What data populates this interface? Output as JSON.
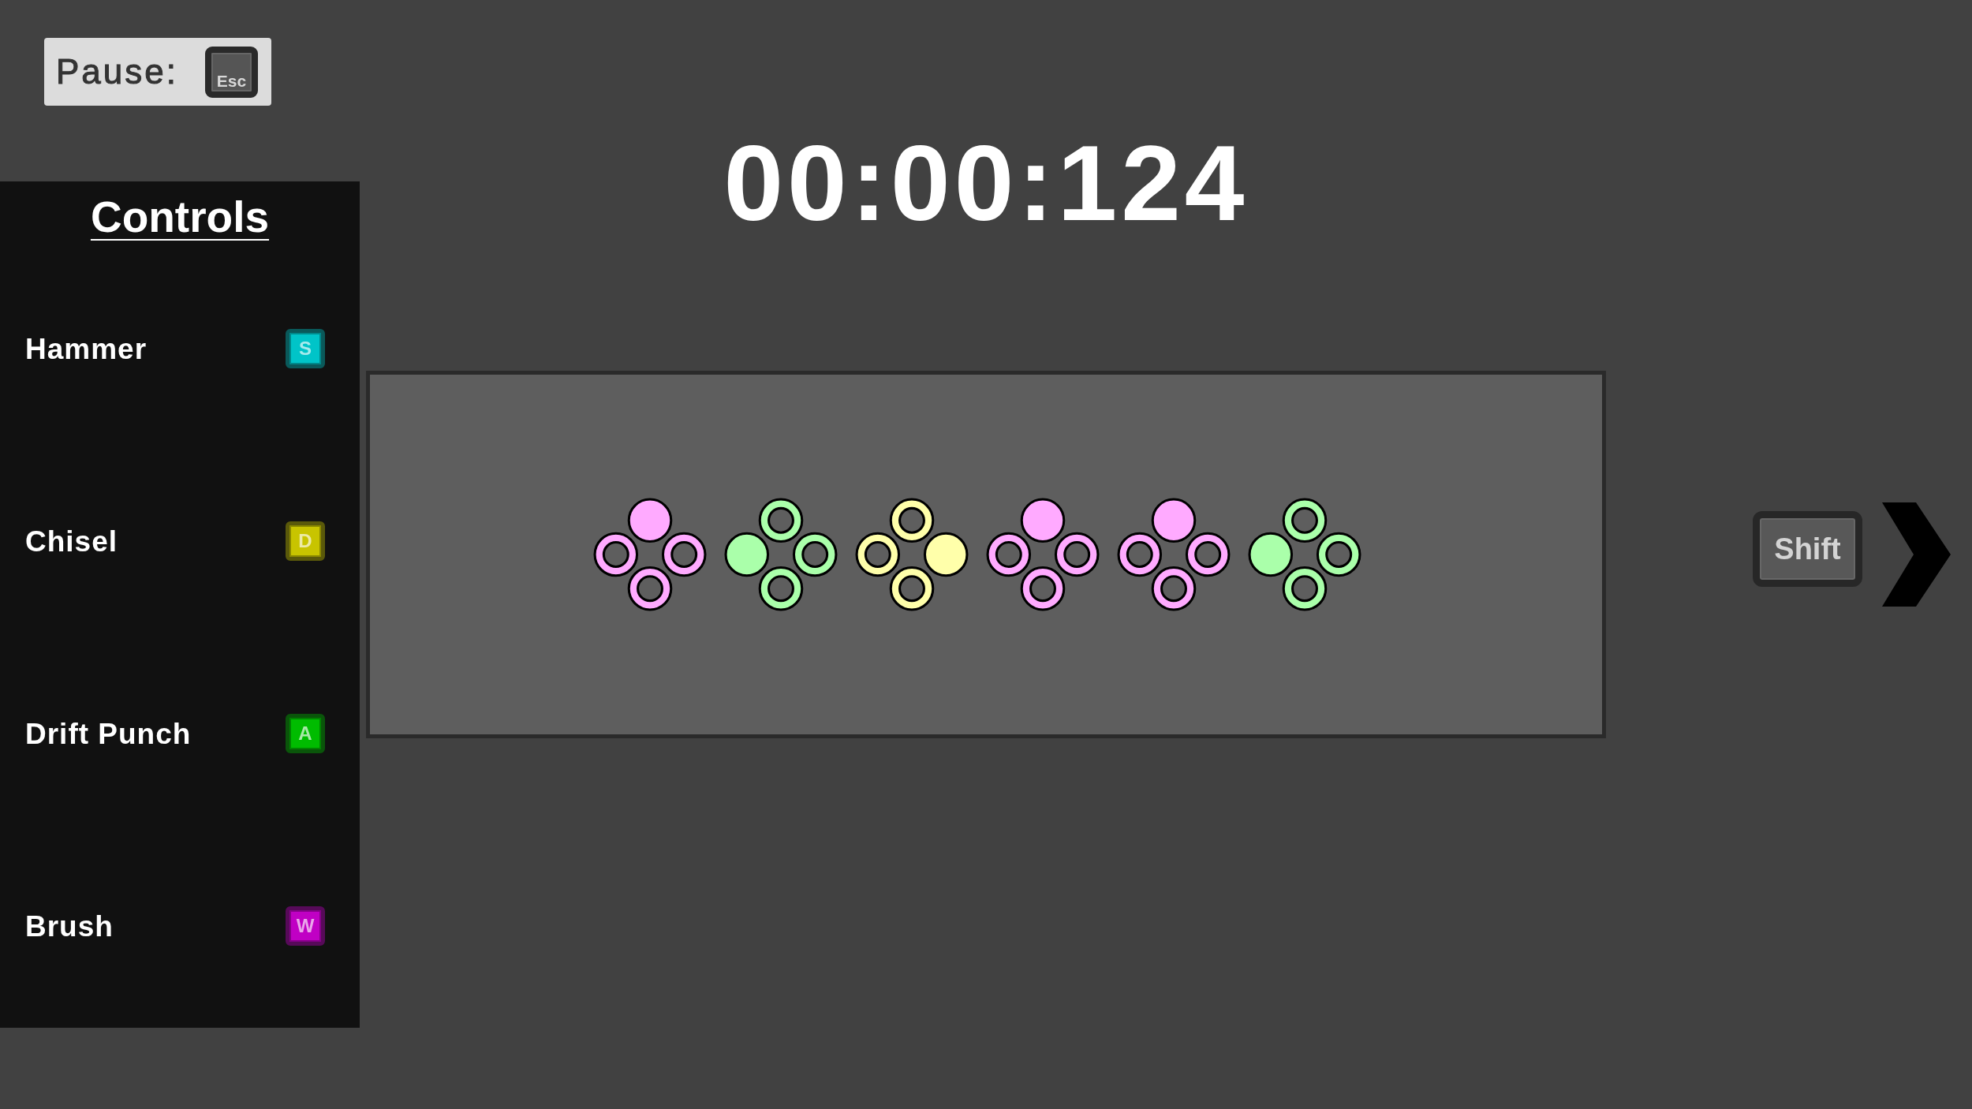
{
  "hud": {
    "pause_label": "Pause:",
    "pause_key": "Esc",
    "timer": "00:00:124"
  },
  "controls": {
    "title": "Controls",
    "items": [
      {
        "label": "Hammer",
        "key": "S",
        "color": "#00c4c8"
      },
      {
        "label": "Chisel",
        "key": "D",
        "color": "#c8c400"
      },
      {
        "label": "Drift Punch",
        "key": "A",
        "color": "#00bc00"
      },
      {
        "label": "Brush",
        "key": "W",
        "color": "#c000c4"
      }
    ]
  },
  "prompts": [
    {
      "color": "#ffaaff",
      "kind": "up"
    },
    {
      "color": "#aaffaa",
      "kind": "left"
    },
    {
      "color": "#ffffaa",
      "kind": "right"
    },
    {
      "color": "#ffaaff",
      "kind": "up"
    },
    {
      "color": "#ffaaff",
      "kind": "up"
    },
    {
      "color": "#aaffaa",
      "kind": "left"
    }
  ],
  "next_hint": {
    "key": "Shift"
  }
}
